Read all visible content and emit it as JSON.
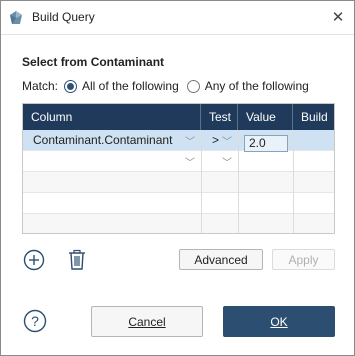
{
  "window": {
    "title": "Build Query",
    "close_glyph": "✕"
  },
  "section": {
    "heading": "Select from Contaminant"
  },
  "match": {
    "label": "Match:",
    "option_all": "All of the following",
    "option_any": "Any of the following",
    "selected": "all"
  },
  "grid": {
    "headers": {
      "column": "Column",
      "test": "Test",
      "value": "Value",
      "build": "Build"
    },
    "rows": [
      {
        "column": "Contaminant.Contaminant",
        "test": ">",
        "value": "2.0",
        "build": "",
        "selected": true
      },
      {
        "column": "",
        "test": "",
        "value": "",
        "build": "",
        "selected": false
      },
      {
        "column": "",
        "test": "",
        "value": "",
        "build": "",
        "selected": false
      },
      {
        "column": "",
        "test": "",
        "value": "",
        "build": "",
        "selected": false
      },
      {
        "column": "",
        "test": "",
        "value": "",
        "build": "",
        "selected": false
      }
    ]
  },
  "buttons": {
    "advanced": "Advanced",
    "apply": "Apply",
    "cancel": "Cancel",
    "ok": "OK"
  },
  "colors": {
    "header_bg": "#1f3a5a",
    "selected_row": "#cfe2f3",
    "primary_button": "#2c4e70"
  }
}
